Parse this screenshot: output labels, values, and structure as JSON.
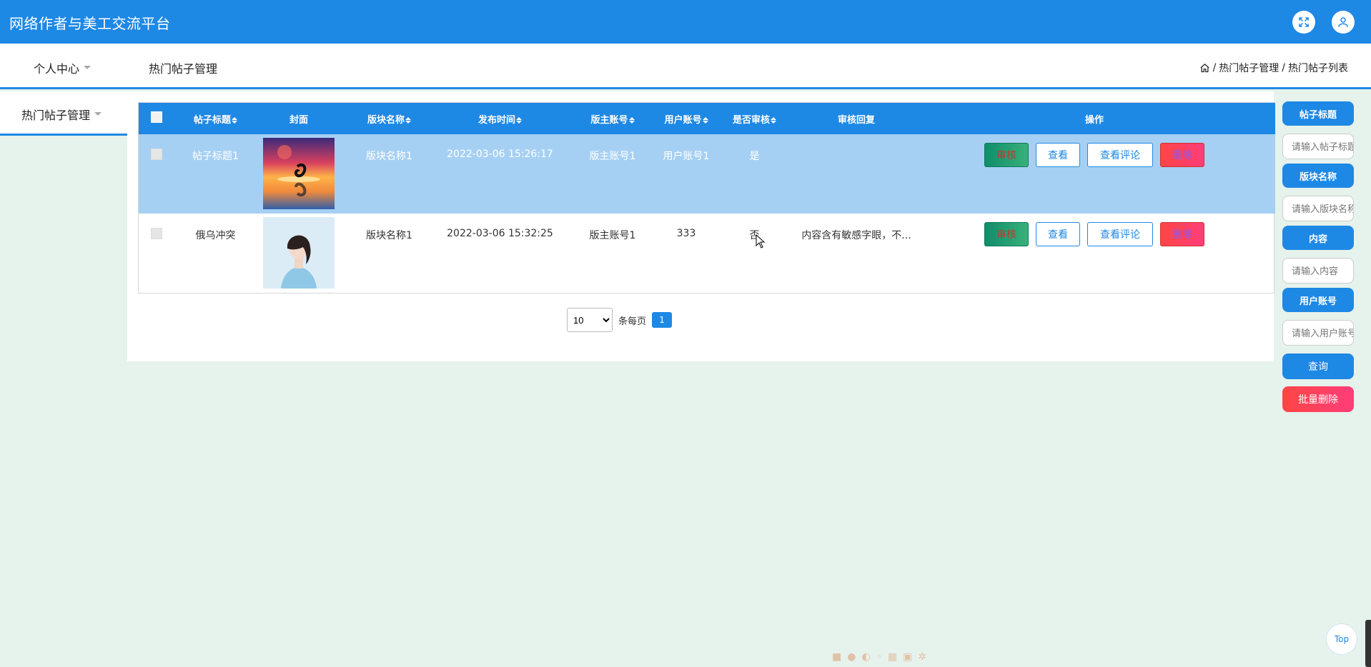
{
  "header": {
    "title": "网络作者与美工交流平台",
    "icons": [
      "fullscreen-icon",
      "user-icon"
    ]
  },
  "nav": {
    "personal_center": "个人中心",
    "hot_posts": "热门帖子管理",
    "breadcrumb": [
      "热门帖子管理",
      "热门帖子列表"
    ],
    "breadcrumb_sep": "/"
  },
  "sidebar": {
    "item": "热门帖子管理"
  },
  "table": {
    "columns": [
      "帖子标题",
      "封面",
      "版块名称",
      "发布时间",
      "版主账号",
      "用户账号",
      "是否审核",
      "审核回复",
      "操作"
    ],
    "rows": [
      {
        "title": "帖子标题1",
        "section": "版块名称1",
        "time": "2022-03-06 15:26:17",
        "moderator": "版主账号1",
        "user": "用户账号1",
        "audited": "是",
        "reply": "",
        "selected": true
      },
      {
        "title": "俄乌冲突",
        "section": "版块名称1",
        "time": "2022-03-06 15:32:25",
        "moderator": "版主账号1",
        "user": "333",
        "audited": "否",
        "reply": "内容含有敏感字眼，不...",
        "selected": false
      }
    ],
    "actions": {
      "audit": "审核",
      "view": "查看",
      "view_comments": "查看评论",
      "delete": "删除"
    }
  },
  "pager": {
    "page_size": "10",
    "page_size_options": [
      "10"
    ],
    "per_page_label": "条每页",
    "current_page": "1"
  },
  "filters": {
    "title_label": "帖子标题",
    "title_placeholder": "请输入帖子标题",
    "section_label": "版块名称",
    "section_placeholder": "请输入版块名称",
    "content_label": "内容",
    "content_placeholder": "请输入内容",
    "user_label": "用户账号",
    "user_placeholder": "请输入用户账号",
    "search_button": "查询",
    "batch_delete_button": "批量删除"
  },
  "top_button": "Top",
  "colors": {
    "primary": "#1e88e5",
    "selected_row": "#a6d0f3",
    "danger": "#ff4545",
    "audit": "#0f8d6b",
    "background": "#e6f2ec"
  }
}
